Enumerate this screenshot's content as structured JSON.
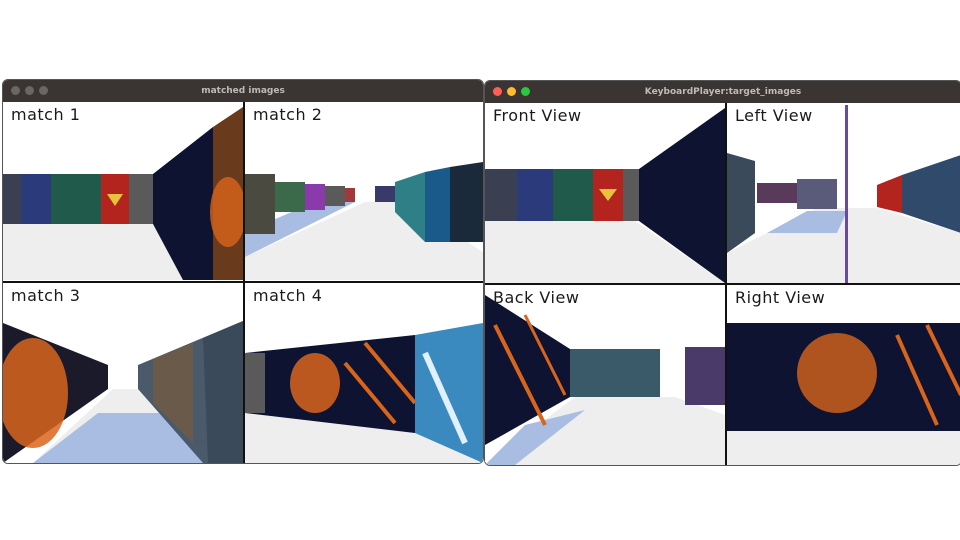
{
  "window_left": {
    "title": "matched images",
    "traffic_lights": [
      "#6b6663",
      "#6b6663",
      "#6b6663"
    ],
    "panes": [
      "match 1",
      "match 2",
      "match 3",
      "match 4"
    ]
  },
  "window_right": {
    "title": "KeyboardPlayer:target_images",
    "traffic_lights": [
      "#ff5f57",
      "#febc2e",
      "#28c840"
    ],
    "panes": [
      "Front View",
      "Left View",
      "Back View",
      "Right View"
    ]
  },
  "colors": {
    "floor": "#eeeeee",
    "floor_blue": "#a9bde3",
    "wall_dark": "#0d1330",
    "wall_orange": "#d9651c",
    "wall_red": "#b3241f",
    "wall_teal": "#2f7f86",
    "wall_grey": "#5a5a5a"
  }
}
